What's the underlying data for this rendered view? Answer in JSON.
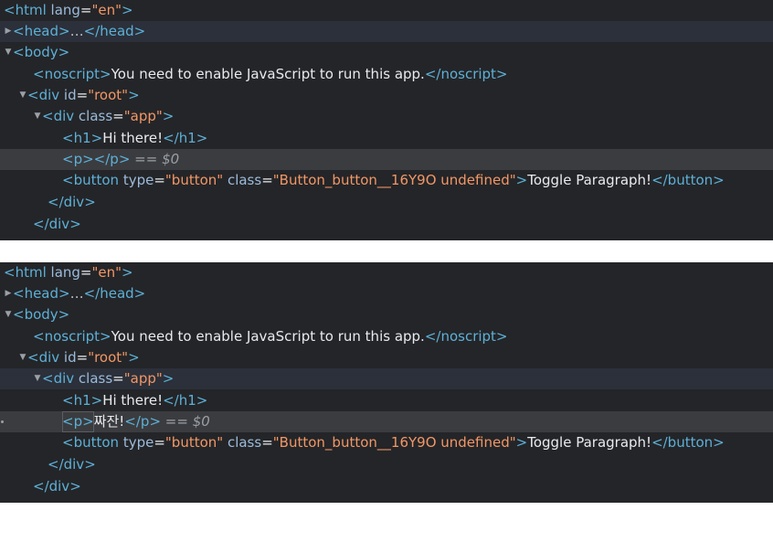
{
  "panels": [
    {
      "lines": {
        "html_open": {
          "lt": "<",
          "name": "html",
          "attr": "lang",
          "eq": "=",
          "val": "\"en\"",
          "gt": ">"
        },
        "head": {
          "open": "<head>",
          "ellipsis": "…",
          "close": "</head>"
        },
        "body_open": {
          "tag": "<body>"
        },
        "noscript": {
          "open": "<noscript>",
          "text": "You need to enable JavaScript to run this app.",
          "close": "</noscript>"
        },
        "div_root": {
          "lt": "<div ",
          "attr": "id",
          "eq": "=",
          "val": "\"root\"",
          "gt": ">"
        },
        "div_app": {
          "lt": "<div ",
          "attr": "class",
          "eq": "=",
          "val": "\"app\"",
          "gt": ">"
        },
        "h1": {
          "open": "<h1>",
          "text": "Hi there!",
          "close": "</h1>"
        },
        "p": {
          "open": "<p>",
          "text": "",
          "close": "</p>",
          "suffix": " == ",
          "ref": "$0"
        },
        "button": {
          "lt": "<button ",
          "attr1": "type",
          "eq1": "=",
          "val1": "\"button\"",
          "attr2": " class",
          "eq2": "=",
          "val2": "\"Button_button__16Y9O undefined\"",
          "gt": ">",
          "text": "Toggle Paragraph!",
          "close": "</button>"
        },
        "div_close_inner": {
          "tag": "</div>"
        },
        "div_close_outer": {
          "tag": "</div>"
        }
      }
    },
    {
      "lines": {
        "html_open": {
          "lt": "<",
          "name": "html",
          "attr": "lang",
          "eq": "=",
          "val": "\"en\"",
          "gt": ">"
        },
        "head": {
          "open": "<head>",
          "ellipsis": "…",
          "close": "</head>"
        },
        "body_open": {
          "tag": "<body>"
        },
        "noscript": {
          "open": "<noscript>",
          "text": "You need to enable JavaScript to run this app.",
          "close": "</noscript>"
        },
        "div_root": {
          "lt": "<div ",
          "attr": "id",
          "eq": "=",
          "val": "\"root\"",
          "gt": ">"
        },
        "div_app": {
          "lt": "<div ",
          "attr": "class",
          "eq": "=",
          "val": "\"app\"",
          "gt": ">"
        },
        "h1": {
          "open": "<h1>",
          "text": "Hi there!",
          "close": "</h1>"
        },
        "p": {
          "open": "<p>",
          "text": "짜잔!",
          "close": "</p>",
          "suffix": " == ",
          "ref": "$0"
        },
        "button": {
          "lt": "<button ",
          "attr1": "type",
          "eq1": "=",
          "val1": "\"button\"",
          "attr2": " class",
          "eq2": "=",
          "val2": "\"Button_button__16Y9O undefined\"",
          "gt": ">",
          "text": "Toggle Paragraph!",
          "close": "</button>"
        },
        "div_close_inner": {
          "tag": "</div>"
        },
        "div_close_outer": {
          "tag": "</div>"
        }
      }
    }
  ],
  "icons": {
    "collapsed": "▶",
    "expanded": "▼"
  },
  "colors": {
    "background": "#242528",
    "tag": "#5db0d7",
    "attribute": "#9bbbdc",
    "value": "#f29766",
    "text": "#e8eaed",
    "selected_row": "#3b3c3f",
    "hover_row": "#2b303a"
  }
}
